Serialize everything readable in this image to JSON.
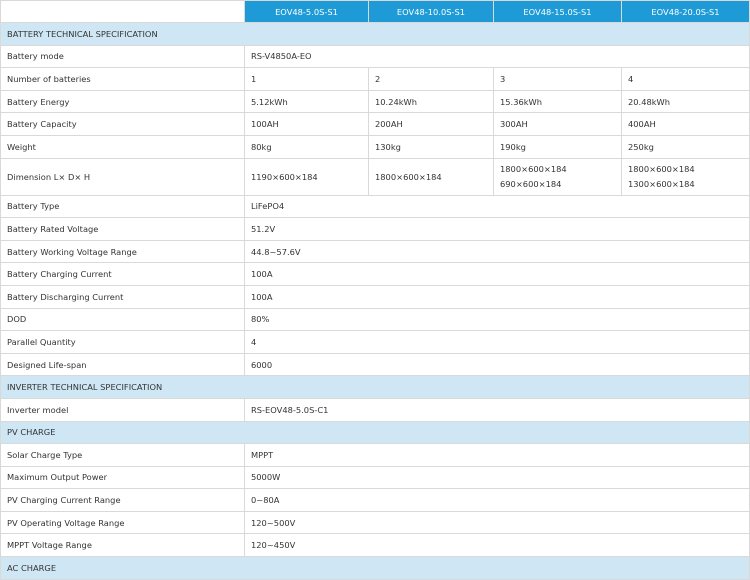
{
  "header": {
    "columns": [
      "EOV48-5.0S-S1",
      "EOV48-10.0S-S1",
      "EOV48-15.0S-S1",
      "EOV48-20.0S-S1"
    ]
  },
  "sections": {
    "battery": "BATTERY TECHNICAL SPECIFICATION",
    "inverter": "INVERTER TECHNICAL SPECIFICATION",
    "pv": "PV CHARGE",
    "ac": "AC CHARGE"
  },
  "battery_rows": {
    "mode": {
      "label": "Battery mode",
      "value": "RS-V4850A-EO"
    },
    "count": {
      "label": "Number of batteries",
      "values": [
        "1",
        "2",
        "3",
        "4"
      ]
    },
    "energy": {
      "label": "Battery Energy",
      "values": [
        "5.12kWh",
        "10.24kWh",
        "15.36kWh",
        "20.48kWh"
      ]
    },
    "capacity": {
      "label": "Battery Capacity",
      "values": [
        "100AH",
        "200AH",
        "300AH",
        "400AH"
      ]
    },
    "weight": {
      "label": "Weight",
      "values": [
        "80kg",
        "130kg",
        "190kg",
        "250kg"
      ]
    },
    "dimension": {
      "label": "Dimension L× D× H",
      "c1": "1190×600×184",
      "c2": "1800×600×184",
      "c3": [
        "1800×600×184",
        "690×600×184"
      ],
      "c4": [
        "1800×600×184",
        "1300×600×184"
      ]
    },
    "type": {
      "label": "Battery Type",
      "value": "LiFePO4"
    },
    "rated_voltage": {
      "label": "Battery Rated Voltage",
      "value": "51.2V"
    },
    "working_range": {
      "label": "Battery Working Voltage Range",
      "value": "44.8~57.6V"
    },
    "charging_current": {
      "label": "Battery Charging Current",
      "value": "100A"
    },
    "discharging_current": {
      "label": "Battery Discharging Current",
      "value": "100A"
    },
    "dod": {
      "label": "DOD",
      "value": "80%"
    },
    "parallel": {
      "label": "Parallel Quantity",
      "value": "4"
    },
    "lifespan": {
      "label": "Designed Life-span",
      "value": "6000"
    }
  },
  "inverter_rows": {
    "model": {
      "label": "Inverter model",
      "value": "RS-EOV48-5.0S-C1"
    }
  },
  "pv_rows": {
    "solar_type": {
      "label": "Solar Charge Type",
      "value": "MPPT"
    },
    "max_power": {
      "label": "Maximum Output Power",
      "value": "5000W"
    },
    "current_range": {
      "label": "PV Charging Current Range",
      "value": "0~80A"
    },
    "voltage_range": {
      "label": "PV Operating Voltage Range",
      "value": "120~500V"
    },
    "mppt_range": {
      "label": "MPPT Voltage Range",
      "value": "120~450V"
    }
  }
}
